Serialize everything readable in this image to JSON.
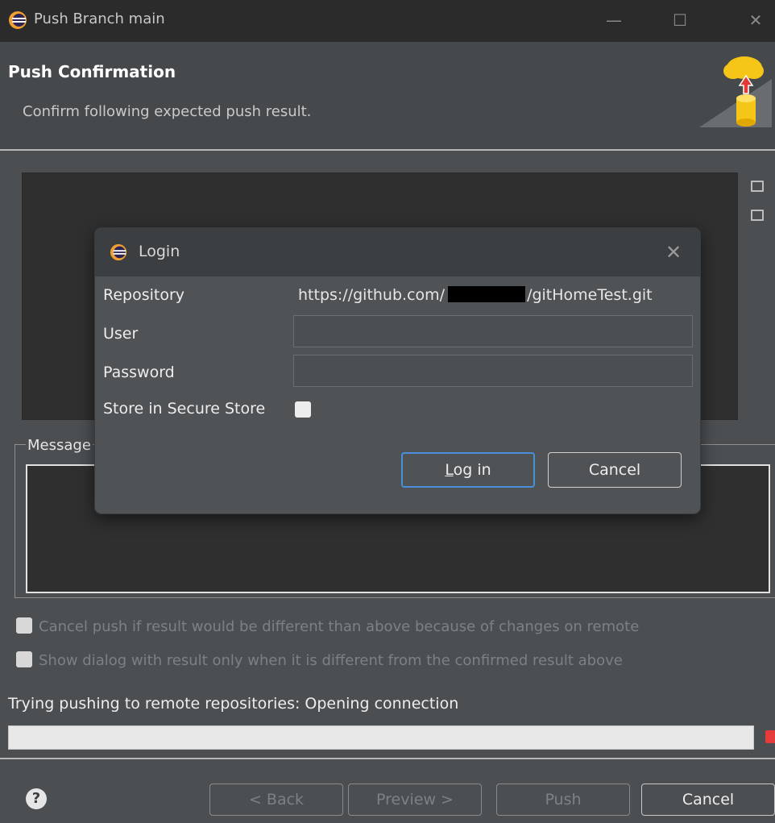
{
  "window": {
    "title": "Push Branch main",
    "minimize": "—",
    "maximize": "☐",
    "close": "✕"
  },
  "banner": {
    "heading": "Push Confirmation",
    "description": "Confirm following expected push result."
  },
  "message_group": {
    "legend": "Message"
  },
  "options": {
    "cancel_if_different": "Cancel push if result would be different than above because of changes on remote",
    "show_dialog_only_when_different": "Show dialog with result only when it is different from the confirmed result above"
  },
  "status": {
    "text": "Trying pushing to remote repositories: Opening connection"
  },
  "buttons": {
    "help": "?",
    "back": "< Back",
    "preview": "Preview >",
    "push": "Push",
    "cancel": "Cancel"
  },
  "login": {
    "title": "Login",
    "close": "✕",
    "repository_label": "Repository",
    "repository_url_prefix": "https://github.com/",
    "repository_url_suffix": "/gitHomeTest.git",
    "user_label": "User",
    "user_value": "",
    "password_label": "Password",
    "password_value": "",
    "store_label": "Store in Secure Store",
    "login_button_mnemonic": "L",
    "login_button_rest": "og in",
    "cancel_button": "Cancel"
  },
  "colors": {
    "background": "#4b4f52",
    "titlebar": "#2b2b2b",
    "accent_focus": "#4a90d9",
    "stop": "#e63b3b"
  }
}
